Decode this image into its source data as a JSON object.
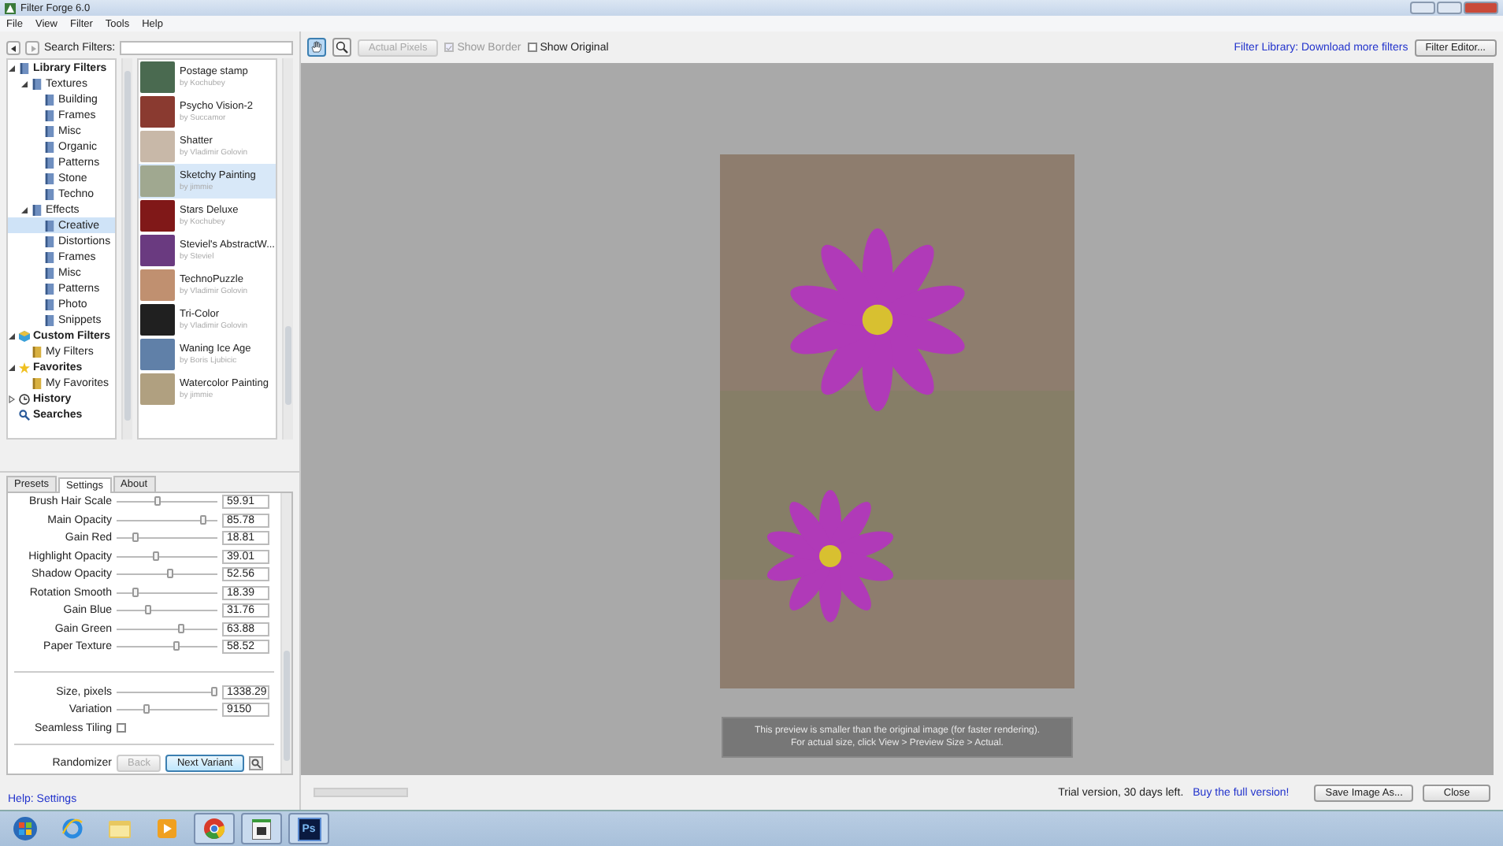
{
  "window": {
    "title": "Filter Forge 6.0"
  },
  "menu": [
    "File",
    "View",
    "Filter",
    "Tools",
    "Help"
  ],
  "search": {
    "label": "Search Filters:"
  },
  "tree": [
    {
      "label": "Library Filters",
      "kind": "library",
      "expanded": true,
      "selected": false,
      "children": [
        {
          "label": "Textures",
          "kind": "category",
          "expanded": true,
          "selected": false,
          "children": [
            {
              "label": "Building",
              "kind": "category",
              "selected": false
            },
            {
              "label": "Frames",
              "kind": "category",
              "selected": false
            },
            {
              "label": "Misc",
              "kind": "category",
              "selected": false
            },
            {
              "label": "Organic",
              "kind": "category",
              "selected": false
            },
            {
              "label": "Patterns",
              "kind": "category",
              "selected": false
            },
            {
              "label": "Stone",
              "kind": "category",
              "selected": false
            },
            {
              "label": "Techno",
              "kind": "category",
              "selected": false
            }
          ]
        },
        {
          "label": "Effects",
          "kind": "category",
          "expanded": true,
          "selected": false,
          "children": [
            {
              "label": "Creative",
              "kind": "category",
              "selected": true
            },
            {
              "label": "Distortions",
              "kind": "category",
              "selected": false
            },
            {
              "label": "Frames",
              "kind": "category",
              "selected": false
            },
            {
              "label": "Misc",
              "kind": "category",
              "selected": false
            },
            {
              "label": "Patterns",
              "kind": "category",
              "selected": false
            },
            {
              "label": "Photo",
              "kind": "category",
              "selected": false
            },
            {
              "label": "Snippets",
              "kind": "category",
              "selected": false
            }
          ]
        }
      ]
    },
    {
      "label": "Custom Filters",
      "kind": "custom",
      "expanded": true,
      "selected": false,
      "children": [
        {
          "label": "My Filters",
          "kind": "folder",
          "selected": false
        }
      ]
    },
    {
      "label": "Favorites",
      "kind": "favorites",
      "expanded": true,
      "selected": false,
      "children": [
        {
          "label": "My Favorites",
          "kind": "folder",
          "selected": false
        }
      ]
    },
    {
      "label": "History",
      "kind": "history",
      "expanded": false,
      "selected": false
    },
    {
      "label": "Searches",
      "kind": "search",
      "selected": false
    }
  ],
  "filters": [
    {
      "name": "Postage stamp",
      "author": "by Kochubey",
      "color": "#4a6a50",
      "selected": false
    },
    {
      "name": "Psycho Vision-2",
      "author": "by Succamor",
      "color": "#8a3a30",
      "selected": false
    },
    {
      "name": "Shatter",
      "author": "by Vladimir Golovin",
      "color": "#c8b8a8",
      "selected": false
    },
    {
      "name": "Sketchy Painting",
      "author": "by jimmie",
      "color": "#a0a890",
      "selected": true
    },
    {
      "name": "Stars Deluxe",
      "author": "by Kochubey",
      "color": "#801818",
      "selected": false
    },
    {
      "name": "Steviel's AbstractW...",
      "author": "by Steviel",
      "color": "#6a3a80",
      "selected": false
    },
    {
      "name": "TechnoPuzzle",
      "author": "by Vladimir Golovin",
      "color": "#c09070",
      "selected": false
    },
    {
      "name": "Tri-Color",
      "author": "by Vladimir Golovin",
      "color": "#202020",
      "selected": false
    },
    {
      "name": "Waning Ice Age",
      "author": "by Boris Ljubicic",
      "color": "#6080a8",
      "selected": false
    },
    {
      "name": "Watercolor Painting",
      "author": "by jimmie",
      "color": "#b0a080",
      "selected": false
    }
  ],
  "tabs": [
    {
      "label": "Presets",
      "selected": false
    },
    {
      "label": "Settings",
      "selected": true
    },
    {
      "label": "About",
      "selected": false
    }
  ],
  "settings": {
    "sliders": [
      {
        "label": "Brush Hair Scale",
        "level": 0.4,
        "value": "59.91"
      },
      {
        "label": "Main Opacity",
        "level": 0.86,
        "value": "85.78"
      },
      {
        "label": "Gain Red",
        "level": 0.19,
        "value": "18.81"
      },
      {
        "label": "Highlight Opacity",
        "level": 0.39,
        "value": "39.01"
      },
      {
        "label": "Shadow Opacity",
        "level": 0.53,
        "value": "52.56"
      },
      {
        "label": "Rotation Smooth",
        "level": 0.18,
        "value": "18.39"
      },
      {
        "label": "Gain Blue",
        "level": 0.32,
        "value": "31.76"
      },
      {
        "label": "Gain Green",
        "level": 0.64,
        "value": "63.88"
      },
      {
        "label": "Paper Texture",
        "level": 0.59,
        "value": "58.52"
      }
    ],
    "sliders2": [
      {
        "label": "Size, pixels",
        "level": 0.97,
        "value": "1338.29"
      },
      {
        "label": "Variation",
        "level": 0.3,
        "value": "9150"
      }
    ],
    "seamless": {
      "label": "Seamless Tiling",
      "checked": false
    },
    "randomizer": {
      "label": "Randomizer",
      "back": "Back",
      "next": "Next Variant"
    }
  },
  "help_link": "Help: Settings",
  "toolbar": {
    "tools": [
      {
        "kind": "hand",
        "selected": true
      },
      {
        "kind": "zoom",
        "selected": false
      }
    ],
    "actual_pixels": "Actual Pixels",
    "show_border": {
      "label": "Show Border",
      "checked": true,
      "disabled": true
    },
    "show_original": {
      "label": "Show Original",
      "checked": false,
      "disabled": false
    },
    "library_link": "Filter Library: Download more filters",
    "filter_editor": "Filter Editor..."
  },
  "preview": {
    "notice": [
      "This preview is smaller than the original image (for faster rendering).",
      "For actual size, click View > Preview Size > Actual."
    ]
  },
  "status": {
    "progress": {
      "level": 0
    },
    "trial": "Trial version, 30 days left.",
    "buy_link": "Buy the full version!",
    "save": "Save Image As...",
    "close": "Close"
  },
  "taskbar": [
    {
      "kind": "start",
      "active": false
    },
    {
      "kind": "ie",
      "active": false
    },
    {
      "kind": "folder",
      "active": false
    },
    {
      "kind": "media",
      "active": false
    },
    {
      "kind": "chrome",
      "active": true
    },
    {
      "kind": "app",
      "active": true
    },
    {
      "kind": "ps",
      "label": "Ps",
      "active": true
    }
  ]
}
